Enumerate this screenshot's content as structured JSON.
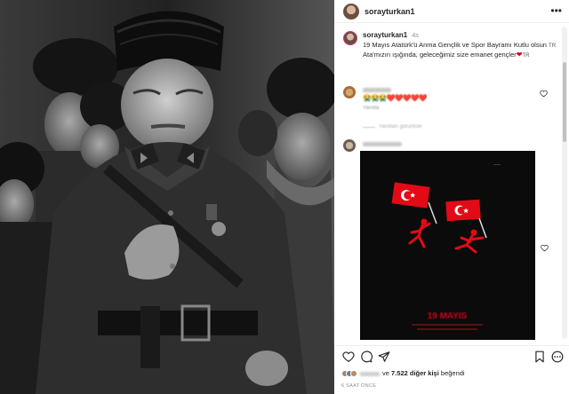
{
  "post": {
    "username": "sorayturkan1",
    "caption_line1": "19 Mayıs Atatürk'ü Anma Gençlik ve Spor Bayramı Kutlu olsun",
    "caption_flag1": "TR",
    "caption_line2_prefix": "Ata'mızın ışığında, geleceğimiz size emanet gençler",
    "caption_flag2": "TR",
    "time_ago": "4s",
    "heart": "❤"
  },
  "comments": [
    {
      "emojis": "😭😭😭❤️❤️❤️❤️❤️",
      "sub": "Yanıtla"
    },
    {
      "reply_toggle": "Yanıtları görüntüle"
    }
  ],
  "poster": {
    "date_text": "19 MAYIS"
  },
  "likes": {
    "others_prefix": "ve",
    "count_text": "7.522 diğer kişi",
    "suffix": "beğendi"
  },
  "timestamp": "6 SAAT ÖNCE",
  "colors": {
    "flag_red": "#e30a17",
    "heart_red": "#d0021b",
    "runner_red": "#e30a17"
  },
  "icons": [
    "heart-icon",
    "comment-icon",
    "share-icon",
    "bookmark-icon",
    "more-icon"
  ]
}
